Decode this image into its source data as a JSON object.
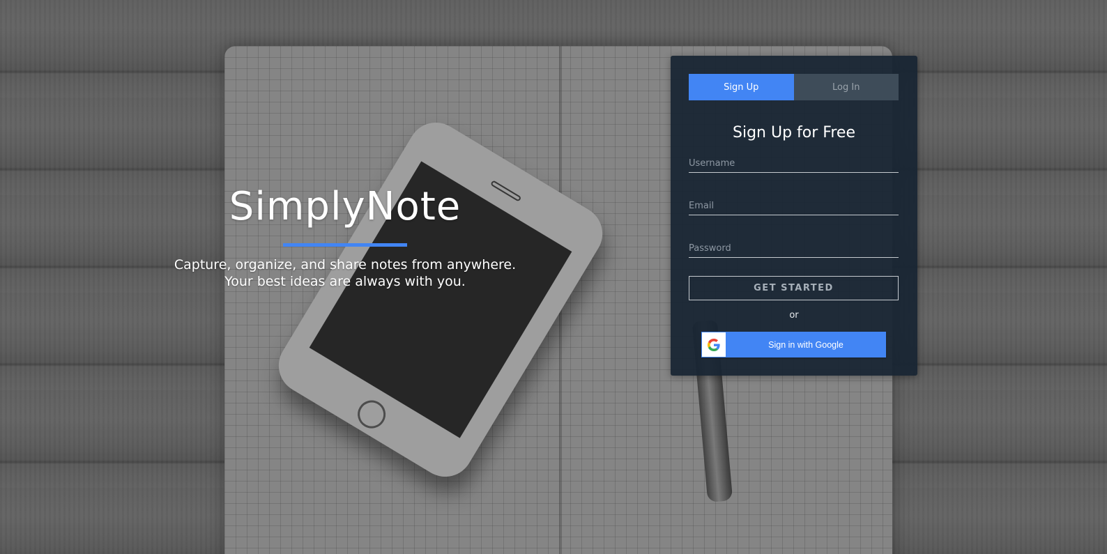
{
  "hero": {
    "title": "SimplyNote",
    "tagline_line1": "Capture, organize, and share notes from anywhere.",
    "tagline_line2": "Your best ideas are always with you."
  },
  "auth": {
    "tabs": [
      {
        "label": "Sign Up",
        "active": true
      },
      {
        "label": "Log In",
        "active": false
      }
    ],
    "title": "Sign Up for Free",
    "fields": {
      "username": {
        "placeholder": "Username",
        "value": ""
      },
      "email": {
        "placeholder": "Email",
        "value": ""
      },
      "password": {
        "placeholder": "Password",
        "value": ""
      }
    },
    "submit_label": "GET STARTED",
    "divider_text": "or",
    "google_label": "Sign in with Google",
    "google_icon": "google-g-icon"
  },
  "colors": {
    "accent": "#4285f4",
    "panel_bg": "#182533",
    "inactive_tab": "#3e4c59"
  }
}
